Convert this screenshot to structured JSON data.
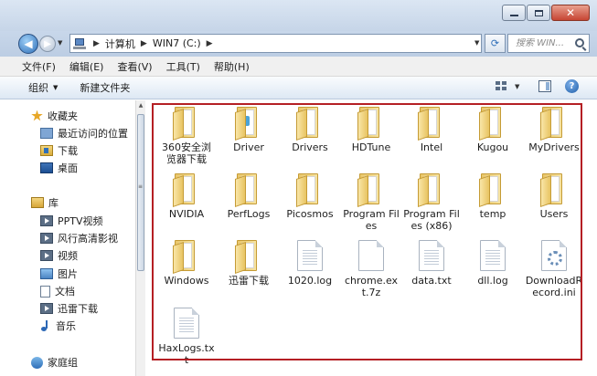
{
  "address": {
    "crumbs": [
      "计算机",
      "WIN7 (C:)"
    ]
  },
  "search": {
    "placeholder": "搜索 WIN..."
  },
  "menu": [
    "文件(F)",
    "编辑(E)",
    "查看(V)",
    "工具(T)",
    "帮助(H)"
  ],
  "toolbar": {
    "organize": "组织",
    "new_folder": "新建文件夹"
  },
  "nav": {
    "favorites": "收藏夹",
    "recent": "最近访问的位置",
    "downloads": "下载",
    "desktop": "桌面",
    "libraries": "库",
    "pptv": "PPTV视频",
    "fengxing": "风行高清影视",
    "videos": "视频",
    "pictures": "图片",
    "documents": "文档",
    "xunlei": "迅雷下载",
    "music": "音乐",
    "homegroup": "家庭组"
  },
  "items": [
    {
      "name": "360安全浏览器下载",
      "kind": "folder"
    },
    {
      "name": "Driver",
      "kind": "folder-special"
    },
    {
      "name": "Drivers",
      "kind": "folder"
    },
    {
      "name": "HDTune",
      "kind": "folder"
    },
    {
      "name": "Intel",
      "kind": "folder"
    },
    {
      "name": "Kugou",
      "kind": "folder"
    },
    {
      "name": "MyDrivers",
      "kind": "folder"
    },
    {
      "name": "NVIDIA",
      "kind": "folder"
    },
    {
      "name": "PerfLogs",
      "kind": "folder"
    },
    {
      "name": "Picosmos",
      "kind": "folder"
    },
    {
      "name": "Program Files",
      "kind": "folder"
    },
    {
      "name": "Program Files (x86)",
      "kind": "folder"
    },
    {
      "name": "temp",
      "kind": "folder"
    },
    {
      "name": "Users",
      "kind": "folder"
    },
    {
      "name": "Windows",
      "kind": "folder"
    },
    {
      "name": "迅雷下载",
      "kind": "folder"
    },
    {
      "name": "1020.log",
      "kind": "file"
    },
    {
      "name": "chrome.ext.7z",
      "kind": "file-blank"
    },
    {
      "name": "data.txt",
      "kind": "file"
    },
    {
      "name": "dll.log",
      "kind": "file"
    },
    {
      "name": "DownloadRecord.ini",
      "kind": "file-config"
    },
    {
      "name": "HaxLogs.txt",
      "kind": "file"
    }
  ],
  "colors": {
    "highlight_border": "#b51f24",
    "folder": "#e9c66a",
    "accent": "#2f6fb8"
  }
}
